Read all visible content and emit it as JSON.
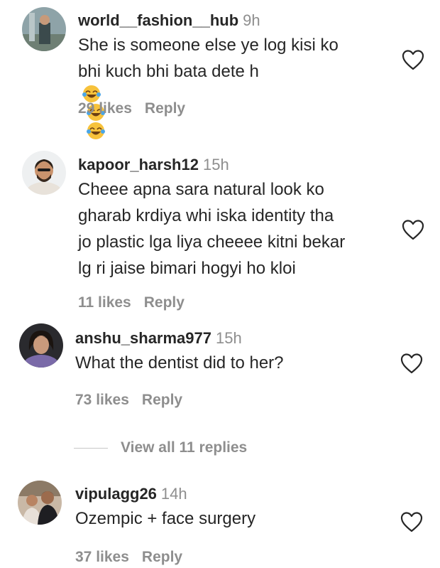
{
  "comments": [
    {
      "username": "world__fashion__hub",
      "time": "9h",
      "lines": [
        "She is someone else ye log kisi ko",
        "bhi kuch bhi bata dete h"
      ],
      "emoji": [
        "face-with-tears-of-joy",
        "face-with-tears-of-joy",
        "face-with-tears-of-joy"
      ],
      "likes": "29 likes",
      "reply": "Reply"
    },
    {
      "username": "kapoor_harsh12",
      "time": "15h",
      "lines": [
        "Cheee apna sara natural look ko",
        "gharab krdiya whi iska identity tha",
        "jo plastic lga liya cheeee kitni bekar",
        "lg ri jaise bimari hogyi ho kloi"
      ],
      "likes": "11 likes",
      "reply": "Reply"
    },
    {
      "username": "anshu_sharma977",
      "time": "15h",
      "lines": [
        "What the dentist did to her?"
      ],
      "likes": "73 likes",
      "reply": "Reply",
      "view_replies": "View all 11 replies"
    },
    {
      "username": "vipulagg26",
      "time": "14h",
      "lines": [
        "Ozempic + face surgery"
      ],
      "likes": "37 likes",
      "reply": "Reply"
    }
  ],
  "icons": {
    "like": "heart-outline-icon",
    "emoji": "face-with-tears-of-joy"
  },
  "colors": {
    "text": "#262626",
    "muted": "#8e8e8e",
    "divider": "#c7c7c7"
  }
}
